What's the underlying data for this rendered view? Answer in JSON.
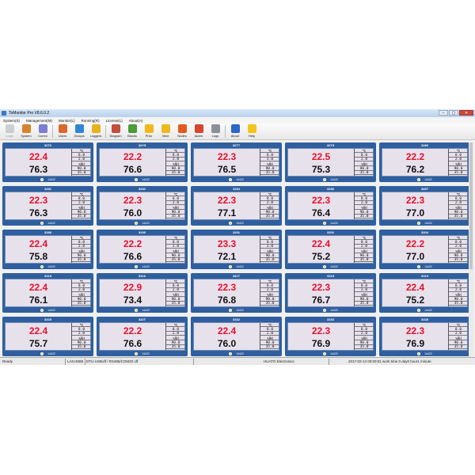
{
  "window": {
    "title": "ToMonitor Pro V8.6.0.2",
    "buttons": [
      "–",
      "▢",
      "✕"
    ]
  },
  "menu": [
    "System(S)",
    "Management(M)",
    "Monitor(L)",
    "Running(R)",
    "License(L)",
    "About(A)"
  ],
  "toolbar": [
    {
      "label": "Login",
      "icon": "login-icon",
      "color": "#9aa2ad",
      "disabled": true
    },
    {
      "label": "System",
      "icon": "system-tools-icon",
      "color": "#d8822b"
    },
    {
      "label": "Comm",
      "icon": "comm-icon",
      "color": "#7a7fd0"
    },
    {
      "sep": true
    },
    {
      "label": "Users",
      "icon": "users-icon",
      "color": "#d9692a"
    },
    {
      "label": "Groups",
      "icon": "groups-icon",
      "color": "#2f86d6"
    },
    {
      "label": "Loggers",
      "icon": "loggers-icon",
      "color": "#e8b21e"
    },
    {
      "sep": true
    },
    {
      "label": "Diagram",
      "icon": "diagram-icon",
      "color": "#c24e3f"
    },
    {
      "label": "Blocks",
      "icon": "blocks-icon",
      "color": "#4a9b3a"
    },
    {
      "label": "Prior",
      "icon": "prior-arrow-icon",
      "color": "#f0b81b"
    },
    {
      "label": "Next",
      "icon": "next-arrow-icon",
      "color": "#f0b81b"
    },
    {
      "label": "Nodes",
      "icon": "nodes-icon",
      "color": "#e25a1f"
    },
    {
      "label": "Alarm",
      "icon": "alarm-icon",
      "color": "#d9462e"
    },
    {
      "label": "Logs",
      "icon": "logs-icon",
      "color": "#8c9199"
    },
    {
      "sep": true
    },
    {
      "label": "About",
      "icon": "about-icon",
      "color": "#2a67c9"
    },
    {
      "label": "Help",
      "icon": "help-icon",
      "color": "#f0c51e"
    }
  ],
  "limits": [
    "℃",
    "8.0",
    "2.0",
    "%RH",
    "90.0",
    "35.0"
  ],
  "panels": [
    {
      "name": "32T0",
      "temp": "22.4",
      "hum": "76.3",
      "foot": "14422"
    },
    {
      "name": "32Y5",
      "temp": "22.2",
      "hum": "76.6",
      "foot": "14422"
    },
    {
      "name": "32TT",
      "temp": "22.3",
      "hum": "76.5",
      "foot": "14422"
    },
    {
      "name": "32T8",
      "temp": "22.5",
      "hum": "75.3",
      "foot": "14422"
    },
    {
      "name": "3280",
      "temp": "22.2",
      "hum": "76.2",
      "foot": "14422"
    },
    {
      "name": "3281",
      "temp": "22.3",
      "hum": "76.3",
      "foot": "14422"
    },
    {
      "name": "3282",
      "temp": "22.3",
      "hum": "76.0",
      "foot": "14422"
    },
    {
      "name": "3284",
      "temp": "22.3",
      "hum": "77.1",
      "foot": "14422"
    },
    {
      "name": "3286",
      "temp": "22.3",
      "hum": "76.4",
      "foot": "14422"
    },
    {
      "name": "328T",
      "temp": "22.3",
      "hum": "77.0",
      "foot": "14422"
    },
    {
      "name": "3288",
      "temp": "22.4",
      "hum": "75.8",
      "foot": "14422"
    },
    {
      "name": "3290",
      "temp": "22.2",
      "hum": "76.6",
      "foot": "14422"
    },
    {
      "name": "3291",
      "temp": "23.3",
      "hum": "72.1",
      "foot": "14422"
    },
    {
      "name": "3302",
      "temp": "22.4",
      "hum": "75.2",
      "foot": "14422"
    },
    {
      "name": "3304",
      "temp": "22.2",
      "hum": "77.0",
      "foot": "14422"
    },
    {
      "name": "3315",
      "temp": "22.4",
      "hum": "76.1",
      "foot": "14422"
    },
    {
      "name": "3316",
      "temp": "22.9",
      "hum": "73.4",
      "foot": "14422"
    },
    {
      "name": "331T",
      "temp": "22.3",
      "hum": "76.8",
      "foot": "14422"
    },
    {
      "name": "3318",
      "temp": "22.3",
      "hum": "76.7",
      "foot": "14422"
    },
    {
      "name": "3319",
      "temp": "22.4",
      "hum": "75.2",
      "foot": "14422"
    },
    {
      "name": "3325",
      "temp": "22.4",
      "hum": "75.7",
      "foot": "14422"
    },
    {
      "name": "332T",
      "temp": "22.2",
      "hum": "76.6",
      "foot": "14422"
    },
    {
      "name": "3332",
      "temp": "22.4",
      "hum": "76.0",
      "foot": "14422"
    },
    {
      "name": "3333",
      "temp": "22.3",
      "hum": "76.9",
      "foot": "14422"
    },
    {
      "name": "3338",
      "temp": "22.3",
      "hum": "76.9",
      "foot": "14422"
    }
  ],
  "status": {
    "ready": "Ready",
    "port": "LAN:4588",
    "conn": "DTU-USBoff / RS485/COM20 off",
    "company": "HUATO Electronics",
    "time": "2017-02-14 00:00:01 work time 0 day0 hour1 minute"
  }
}
